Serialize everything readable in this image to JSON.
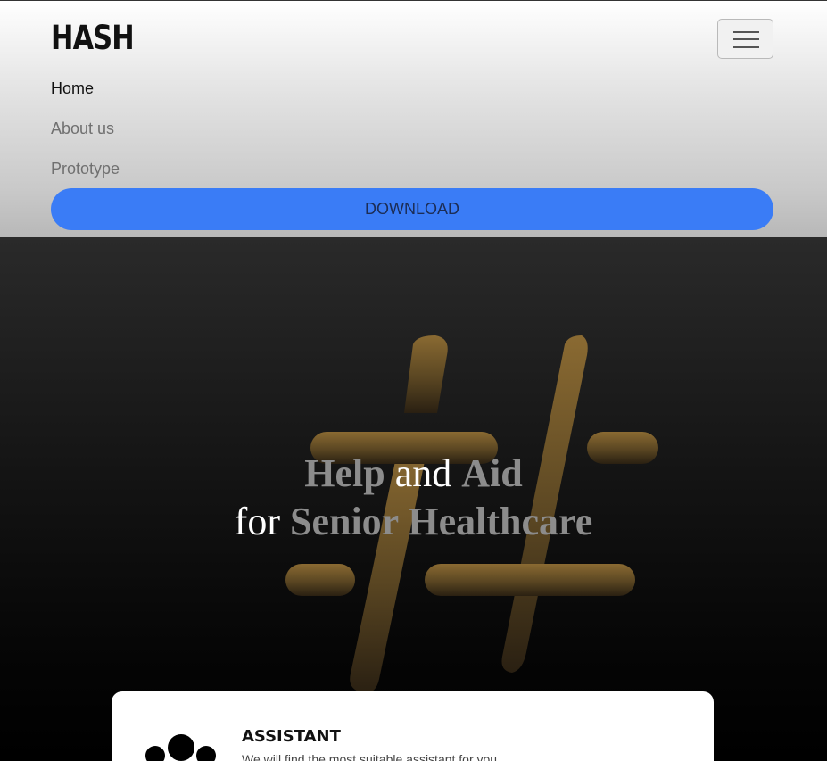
{
  "navbar": {
    "brand": "HASH",
    "toggle_icon": "hamburger-menu-icon",
    "links": [
      {
        "label": "Home",
        "active": true
      },
      {
        "label": "About us",
        "active": false
      },
      {
        "label": "Prototype",
        "active": false
      }
    ],
    "download_label": "DOWNLOAD"
  },
  "hero": {
    "logo_icon": "hash-symbol-icon",
    "title_line1": {
      "part1": "Help",
      "part2": "and",
      "part3": "Aid"
    },
    "title_line2": {
      "part1": "for",
      "part2": "Senior Healthcare"
    }
  },
  "card": {
    "icon": "group-dots-icon",
    "title": "ASSISTANT",
    "text": "We will find the most suitable assistant for you"
  },
  "colors": {
    "accent_blue": "#3a7cf6",
    "logo_gold": "#8a6a2e",
    "hero_bg": "#141414",
    "title_gray": "#8c8c8c"
  }
}
